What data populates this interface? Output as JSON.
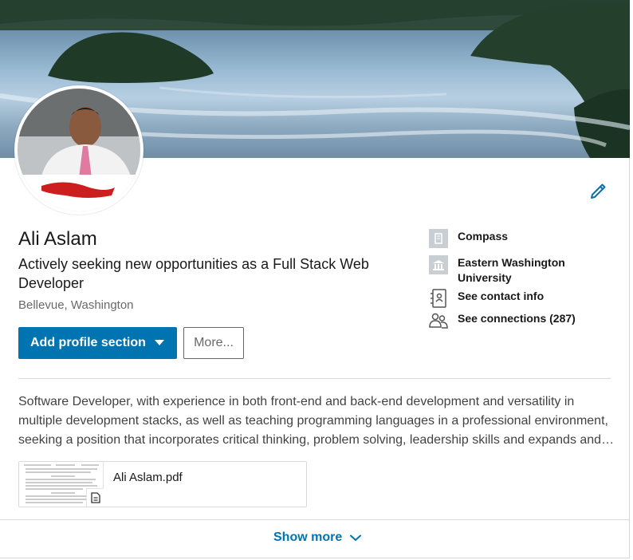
{
  "profile": {
    "name": "Ali Aslam",
    "headline": "Actively seeking new opportunities as a Full Stack Web Developer",
    "location": "Bellevue, Washington"
  },
  "actions": {
    "primary_label": "Add profile section",
    "secondary_label": "More..."
  },
  "sidebar": {
    "company": "Compass",
    "school": "Eastern Washington University",
    "contact": "See contact info",
    "connections": "See connections (287)"
  },
  "summary": "Software Developer, with experience in both front-end and back-end development and versatility in multiple development stacks, as well as teaching programming languages in a professional environment, seeking a position that incorporates critical thinking, problem solving, leadership skills and expands and…",
  "document": {
    "filename": "Ali Aslam.pdf"
  },
  "footer": {
    "show_more_label": "Show more"
  },
  "icons": {
    "edit": "pencil-icon",
    "company": "building-icon",
    "school": "school-icon",
    "contact": "contact-card-icon",
    "connections": "people-icon",
    "document": "document-icon",
    "chevron": "chevron-down-icon"
  },
  "colors": {
    "brand_blue": "#0073b1",
    "text_primary": "#000000",
    "text_secondary": "#666666"
  }
}
